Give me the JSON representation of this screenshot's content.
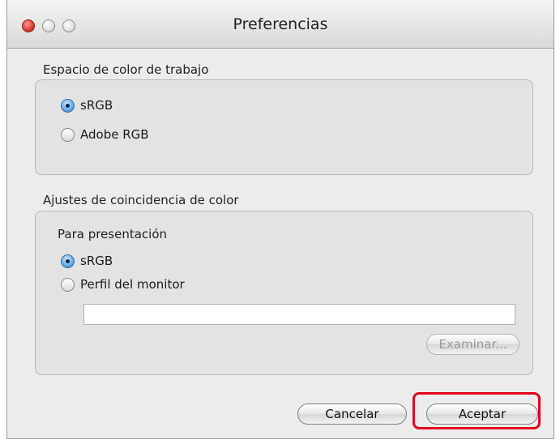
{
  "window": {
    "title": "Preferencias"
  },
  "workspace": {
    "label": "Espacio de color de trabajo",
    "options": [
      {
        "label": "sRGB",
        "selected": true
      },
      {
        "label": "Adobe RGB",
        "selected": false
      }
    ]
  },
  "matching": {
    "label": "Ajustes de coincidencia de color",
    "sublabel": "Para presentación",
    "options": [
      {
        "label": "sRGB",
        "selected": true
      },
      {
        "label": "Perfil del monitor",
        "selected": false
      }
    ],
    "profile_path_value": "",
    "browse_label": "Examinar..."
  },
  "buttons": {
    "cancel_label": "Cancelar",
    "ok_label": "Aceptar"
  },
  "colors": {
    "highlight": "#e3001b",
    "radio_selected": "#3a87d6"
  }
}
